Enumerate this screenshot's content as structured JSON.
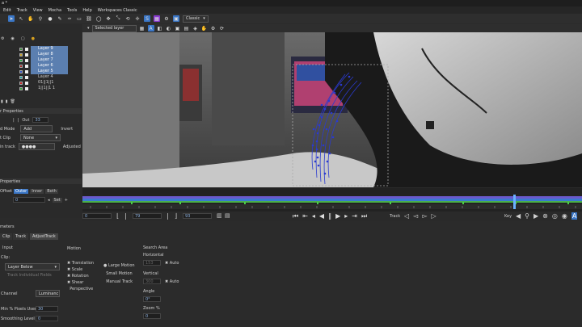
{
  "title_bar": "a *",
  "menu": [
    "Edit",
    "Track",
    "View",
    "Mocha",
    "Tools",
    "Help",
    "Workspaces Classic"
  ],
  "toolbar": {
    "view_mode": "Classic"
  },
  "viewer_bar": {
    "layer_selector": "Selected layer"
  },
  "layers_panel": {
    "layers": [
      {
        "name": "Layer 9",
        "color": "#3a8a3a",
        "selected": true
      },
      {
        "name": "Layer 8",
        "color": "#c8a020",
        "selected": true
      },
      {
        "name": "Layer 7",
        "color": "#20a040",
        "selected": true
      },
      {
        "name": "Layer 6",
        "color": "#a02020",
        "selected": true
      },
      {
        "name": "Layer 5",
        "color": "#3050c0",
        "selected": true
      },
      {
        "name": "Layer 4",
        "color": "#20a0a0",
        "selected": false
      },
      {
        "name": "01||1||1",
        "color": "#c02020",
        "selected": false
      },
      {
        "name": "1||1||1 1",
        "color": "#30a030",
        "selected": false
      }
    ]
  },
  "layer_properties": {
    "title": "r Properties",
    "out_label": "Out",
    "out_value": "33",
    "blend_mode_label": "d Mode",
    "blend_mode_value": "Add",
    "invert_label": "Invert",
    "clip_label": "t Clip",
    "clip_value": "None",
    "track_label": "in track",
    "track_value": "●●●●",
    "adjusted_label": "Adjusted"
  },
  "edge_properties": {
    "title": "Properties",
    "offset_label": "Offset",
    "buttons": [
      "Outer",
      "Inner",
      "Both"
    ],
    "active_button": "Outer",
    "value": "0",
    "set_label": "Set"
  },
  "timeline": {
    "start": "0",
    "current": "79",
    "end": "93",
    "track_label": "Track",
    "key_label": "Key"
  },
  "params": {
    "panel_title": "meters",
    "tabs": [
      "Clip",
      "Track",
      "AdjustTrack"
    ],
    "active_tab": "AdjustTrack",
    "input_label": "Input",
    "clip_label": "Clip:",
    "clip_value": "Layer Below",
    "track_individual": "Track Individual Fields",
    "channel_label": "Channel",
    "channel_value": "Luminanc",
    "min_pixels_label": "Min % Pixels Used",
    "min_pixels_value": "30",
    "smoothing_label": "Smoothing Level",
    "smoothing_value": "0",
    "motion_title": "Motion",
    "motion_checks": [
      "Translation",
      "Scale",
      "Rotation",
      "Shear",
      "Perspective"
    ],
    "motion_radios": [
      "Large Motion",
      "Small Motion",
      "Manual Track"
    ],
    "search_area_title": "Search Area",
    "horizontal_label": "Horizontal",
    "horizontal_value": "153",
    "vertical_label": "Vertical",
    "vertical_value": "300",
    "auto_label": "Auto",
    "angle_label": "Angle",
    "angle_value": "0°",
    "zoom_label": "Zoom %",
    "zoom_value": "0"
  }
}
